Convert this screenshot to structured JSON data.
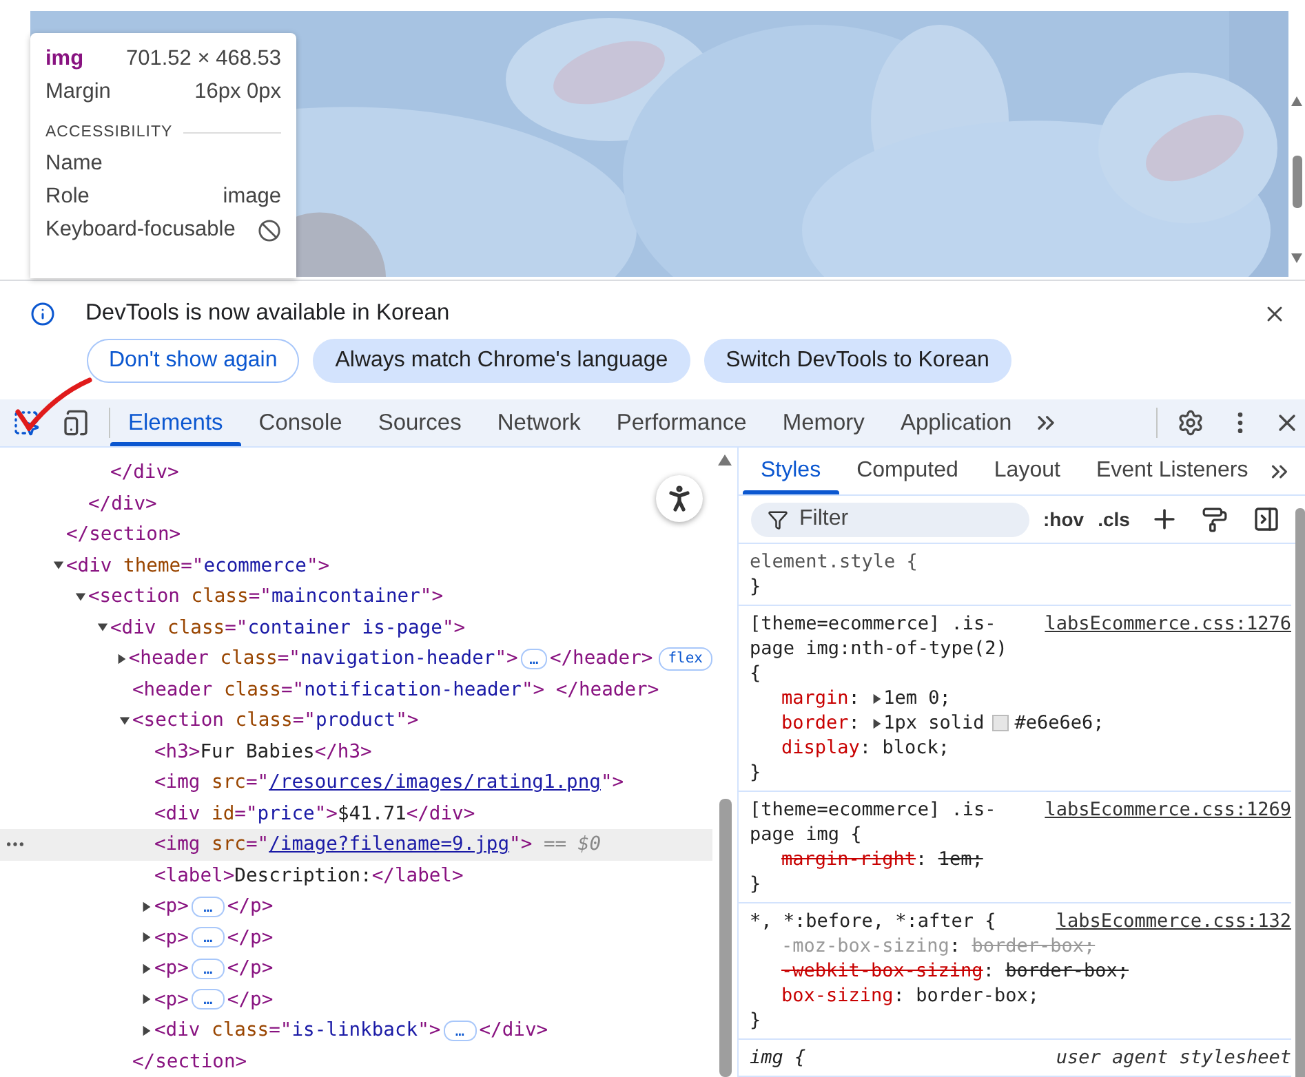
{
  "inspect_tooltip": {
    "tag": "img",
    "size": "701.52 × 468.53",
    "rows": [
      {
        "label": "Margin",
        "value": "16px 0px"
      }
    ],
    "section": "ACCESSIBILITY",
    "a11y": [
      {
        "label": "Name"
      },
      {
        "label": "Role",
        "value": "image"
      },
      {
        "label": "Keyboard-focusable",
        "focusable": false
      }
    ]
  },
  "infobar": {
    "message": "DevTools is now available in Korean",
    "buttons": [
      {
        "label": "Don't show again",
        "kind": "outlined"
      },
      {
        "label": "Always match Chrome's language",
        "kind": "filled"
      },
      {
        "label": "Switch DevTools to Korean",
        "kind": "filled"
      }
    ]
  },
  "toolbar": {
    "inspect_active": true,
    "tabs": [
      {
        "label": "Elements",
        "selected": true
      },
      {
        "label": "Console",
        "selected": false
      },
      {
        "label": "Sources",
        "selected": false
      },
      {
        "label": "Network",
        "selected": false
      },
      {
        "label": "Performance",
        "selected": false
      },
      {
        "label": "Memory",
        "selected": false
      },
      {
        "label": "Application",
        "selected": false
      }
    ]
  },
  "dom": {
    "nodes": [
      {
        "selected": false,
        "closing": [
          {
            "kind": "tag",
            "s": "</section>"
          }
        ],
        "children": [
          {
            "selected": false,
            "closing": [
              {
                "kind": "tag",
                "s": "</div>"
              }
            ],
            "children": [
              {
                "selected": false,
                "closing": [
                  {
                    "kind": "tag",
                    "s": "</div>"
                  }
                ]
              }
            ]
          }
        ]
      },
      {
        "selected": false,
        "expanded": true,
        "tokens": [
          {
            "kind": "tag",
            "s": "<div "
          },
          {
            "kind": "attr",
            "s": "theme"
          },
          {
            "kind": "tag",
            "s": "=\""
          },
          {
            "kind": "value",
            "s": "ecommerce"
          },
          {
            "kind": "tag",
            "s": "\">"
          }
        ],
        "children": [
          {
            "selected": false,
            "expanded": true,
            "tokens": [
              {
                "kind": "tag",
                "s": "<section "
              },
              {
                "kind": "attr",
                "s": "class"
              },
              {
                "kind": "tag",
                "s": "=\""
              },
              {
                "kind": "value",
                "s": "maincontainer"
              },
              {
                "kind": "tag",
                "s": "\">"
              }
            ],
            "children": [
              {
                "selected": false,
                "expanded": true,
                "tokens": [
                  {
                    "kind": "tag",
                    "s": "<div "
                  },
                  {
                    "kind": "attr",
                    "s": "class"
                  },
                  {
                    "kind": "tag",
                    "s": "=\""
                  },
                  {
                    "kind": "value",
                    "s": "container is-page"
                  },
                  {
                    "kind": "tag",
                    "s": "\">"
                  }
                ],
                "children": [
                  {
                    "selected": false,
                    "expanded": false,
                    "tokens": [
                      {
                        "kind": "tag",
                        "s": "<header "
                      },
                      {
                        "kind": "attr",
                        "s": "class"
                      },
                      {
                        "kind": "tag",
                        "s": "=\""
                      },
                      {
                        "kind": "value",
                        "s": "navigation-header"
                      },
                      {
                        "kind": "tag",
                        "s": "\">"
                      },
                      {
                        "kind": "more",
                        "s": "…"
                      },
                      {
                        "kind": "tag",
                        "s": "</header>"
                      },
                      {
                        "kind": "badge",
                        "s": "flex"
                      }
                    ]
                  },
                  {
                    "selected": false,
                    "tokens": [
                      {
                        "kind": "tag",
                        "s": "<header "
                      },
                      {
                        "kind": "attr",
                        "s": "class"
                      },
                      {
                        "kind": "tag",
                        "s": "=\""
                      },
                      {
                        "kind": "value",
                        "s": "notification-header"
                      },
                      {
                        "kind": "tag",
                        "s": "\"> </header>"
                      }
                    ]
                  },
                  {
                    "selected": false,
                    "expanded": true,
                    "tokens": [
                      {
                        "kind": "tag",
                        "s": "<section "
                      },
                      {
                        "kind": "attr",
                        "s": "class"
                      },
                      {
                        "kind": "tag",
                        "s": "=\""
                      },
                      {
                        "kind": "value",
                        "s": "product"
                      },
                      {
                        "kind": "tag",
                        "s": "\">"
                      }
                    ],
                    "closing": [
                      {
                        "kind": "tag",
                        "s": "</section>"
                      }
                    ],
                    "children": [
                      {
                        "selected": false,
                        "tokens": [
                          {
                            "kind": "tag",
                            "s": "<h3>"
                          },
                          {
                            "kind": "text",
                            "s": "Fur Babies"
                          },
                          {
                            "kind": "tag",
                            "s": "</h3>"
                          }
                        ]
                      },
                      {
                        "selected": false,
                        "tokens": [
                          {
                            "kind": "tag",
                            "s": "<img "
                          },
                          {
                            "kind": "attr",
                            "s": "src"
                          },
                          {
                            "kind": "tag",
                            "s": "=\""
                          },
                          {
                            "kind": "link",
                            "s": "/resources/images/rating1.png"
                          },
                          {
                            "kind": "tag",
                            "s": "\">"
                          }
                        ]
                      },
                      {
                        "selected": false,
                        "tokens": [
                          {
                            "kind": "tag",
                            "s": "<div "
                          },
                          {
                            "kind": "attr",
                            "s": "id"
                          },
                          {
                            "kind": "tag",
                            "s": "=\""
                          },
                          {
                            "kind": "value",
                            "s": "price"
                          },
                          {
                            "kind": "tag",
                            "s": "\">"
                          },
                          {
                            "kind": "text",
                            "s": "$41.71"
                          },
                          {
                            "kind": "tag",
                            "s": "</div>"
                          }
                        ]
                      },
                      {
                        "selected": true,
                        "tokens": [
                          {
                            "kind": "tag",
                            "s": "<img "
                          },
                          {
                            "kind": "attr",
                            "s": "src"
                          },
                          {
                            "kind": "tag",
                            "s": "=\""
                          },
                          {
                            "kind": "link",
                            "s": "/image?filename=9.jpg"
                          },
                          {
                            "kind": "tag",
                            "s": "\">"
                          },
                          {
                            "kind": "hint",
                            "s": " == $0"
                          }
                        ]
                      },
                      {
                        "selected": false,
                        "tokens": [
                          {
                            "kind": "tag",
                            "s": "<label>"
                          },
                          {
                            "kind": "text",
                            "s": "Description:"
                          },
                          {
                            "kind": "tag",
                            "s": "</label>"
                          }
                        ]
                      },
                      {
                        "selected": false,
                        "expanded": false,
                        "tokens": [
                          {
                            "kind": "tag",
                            "s": "<p>"
                          },
                          {
                            "kind": "more",
                            "s": "…"
                          },
                          {
                            "kind": "tag",
                            "s": "</p>"
                          }
                        ]
                      },
                      {
                        "selected": false,
                        "expanded": false,
                        "tokens": [
                          {
                            "kind": "tag",
                            "s": "<p>"
                          },
                          {
                            "kind": "more",
                            "s": "…"
                          },
                          {
                            "kind": "tag",
                            "s": "</p>"
                          }
                        ]
                      },
                      {
                        "selected": false,
                        "expanded": false,
                        "tokens": [
                          {
                            "kind": "tag",
                            "s": "<p>"
                          },
                          {
                            "kind": "more",
                            "s": "…"
                          },
                          {
                            "kind": "tag",
                            "s": "</p>"
                          }
                        ]
                      },
                      {
                        "selected": false,
                        "expanded": false,
                        "tokens": [
                          {
                            "kind": "tag",
                            "s": "<p>"
                          },
                          {
                            "kind": "more",
                            "s": "…"
                          },
                          {
                            "kind": "tag",
                            "s": "</p>"
                          }
                        ]
                      },
                      {
                        "selected": false,
                        "expanded": false,
                        "tokens": [
                          {
                            "kind": "tag",
                            "s": "<div "
                          },
                          {
                            "kind": "attr",
                            "s": "class"
                          },
                          {
                            "kind": "tag",
                            "s": "=\""
                          },
                          {
                            "kind": "value",
                            "s": "is-linkback"
                          },
                          {
                            "kind": "tag",
                            "s": "\">"
                          },
                          {
                            "kind": "more",
                            "s": "…"
                          },
                          {
                            "kind": "tag",
                            "s": "</div>"
                          }
                        ]
                      }
                    ]
                  }
                ]
              }
            ]
          }
        ]
      }
    ]
  },
  "styles": {
    "tabs": [
      {
        "label": "Styles",
        "selected": true
      },
      {
        "label": "Computed",
        "selected": false
      },
      {
        "label": "Layout",
        "selected": false
      },
      {
        "label": "Event Listeners",
        "selected": false
      }
    ],
    "filter": {
      "placeholder": "Filter"
    },
    "toggles": [
      ":hov",
      ".cls"
    ],
    "rules": [
      {
        "kind": "inline",
        "selector": "element.style {",
        "close": "}"
      },
      {
        "kind": "author",
        "selector": "[theme=ecommerce] .is-page img:nth-of-type(2) {",
        "source": "labsEcommerce.css:1276",
        "close": "}",
        "props": [
          {
            "kind": "normal",
            "name": "margin",
            "colon": ":",
            "expandable": true,
            "value": "1em 0;"
          },
          {
            "kind": "normal",
            "name": "border",
            "colon": ":",
            "expandable": true,
            "value": "1px solid",
            "color": "#e6e6e6",
            "color_value": "#e6e6e6;"
          },
          {
            "kind": "normal",
            "name": "display",
            "colon": ":",
            "value": "block;"
          }
        ]
      },
      {
        "kind": "author",
        "selector": "[theme=ecommerce] .is-page img {",
        "source": "labsEcommerce.css:1269",
        "close": "}",
        "props": [
          {
            "kind": "overridden",
            "name": "margin-right",
            "colon": ":",
            "value": "1em;"
          }
        ]
      },
      {
        "kind": "author",
        "selector": "*, *:before, *:after {",
        "source": "labsEcommerce.css:132",
        "close": "}",
        "props": [
          {
            "kind": "inactive",
            "name": "-moz-box-sizing",
            "colon": ":",
            "value": "border-box;"
          },
          {
            "kind": "overridden",
            "name": "-webkit-box-sizing",
            "colon": ":",
            "value": "border-box;"
          },
          {
            "kind": "normal",
            "name": "box-sizing",
            "colon": ":",
            "value": "border-box;"
          }
        ]
      },
      {
        "kind": "user-agent",
        "selector": "img {",
        "source": "user agent stylesheet"
      }
    ]
  }
}
